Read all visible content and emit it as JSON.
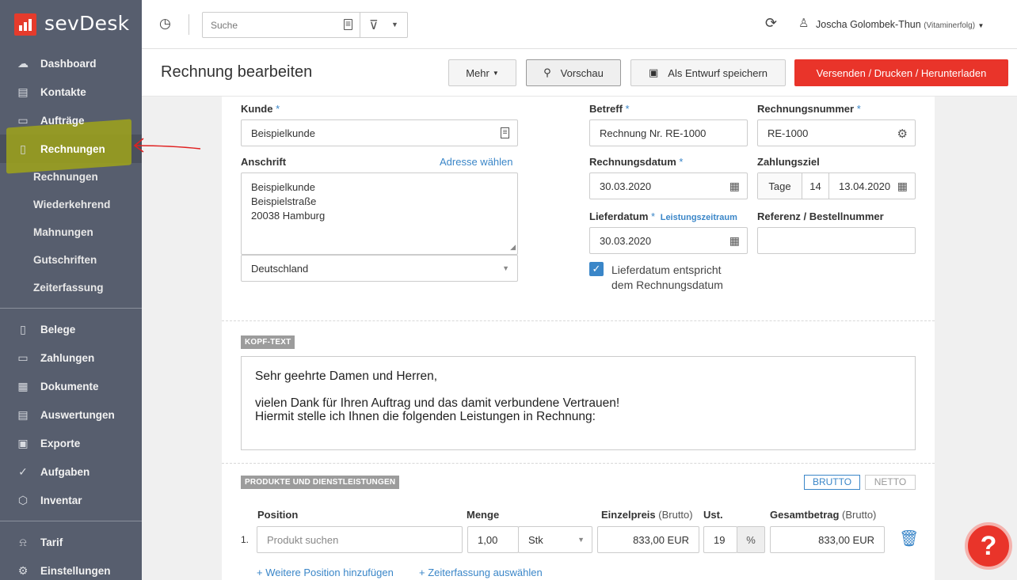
{
  "brand": {
    "name": "sevDesk"
  },
  "sidebar": {
    "items": [
      {
        "label": "Dashboard",
        "icon": "cloud-icon"
      },
      {
        "label": "Kontakte",
        "icon": "contact-card-icon"
      },
      {
        "label": "Aufträge",
        "icon": "folder-icon"
      },
      {
        "label": "Rechnungen",
        "icon": "document-icon"
      },
      {
        "label": "Belege",
        "icon": "receipt-icon"
      },
      {
        "label": "Zahlungen",
        "icon": "credit-card-icon"
      },
      {
        "label": "Dokumente",
        "icon": "calendar-doc-icon"
      },
      {
        "label": "Auswertungen",
        "icon": "chart-icon"
      },
      {
        "label": "Exporte",
        "icon": "export-icon"
      },
      {
        "label": "Aufgaben",
        "icon": "checkmark-icon"
      },
      {
        "label": "Inventar",
        "icon": "box-icon"
      },
      {
        "label": "Tarif",
        "icon": "bell-icon"
      },
      {
        "label": "Einstellungen",
        "icon": "gear-icon"
      }
    ],
    "subitems": [
      "Rechnungen",
      "Wiederkehrend",
      "Mahnungen",
      "Gutschriften",
      "Zeiterfassung"
    ]
  },
  "topbar": {
    "search_placeholder": "Suche",
    "user": "Joscha Golombek-Thun",
    "org": "(Vitaminerfolg)"
  },
  "header": {
    "title": "Rechnung bearbeiten",
    "more": "Mehr",
    "preview": "Vorschau",
    "draft": "Als Entwurf speichern",
    "send": "Versenden / Drucken / Herunterladen"
  },
  "form": {
    "kunde_label": "Kunde",
    "kunde_value": "Beispielkunde",
    "anschrift_label": "Anschrift",
    "adresse_link": "Adresse wählen",
    "address_lines": [
      "Beispielkunde",
      "Beispielstraße",
      "20038 Hamburg"
    ],
    "country": "Deutschland",
    "betreff_label": "Betreff",
    "betreff_value": "Rechnung Nr. RE-1000",
    "nummer_label": "Rechnungsnummer",
    "nummer_value": "RE-1000",
    "datum_label": "Rechnungsdatum",
    "datum_value": "30.03.2020",
    "ziel_label": "Zahlungsziel",
    "ziel_unit": "Tage",
    "ziel_days": "14",
    "ziel_date": "13.04.2020",
    "liefer_label": "Lieferdatum",
    "liefer_link": "Leistungszeitraum",
    "liefer_value": "30.03.2020",
    "referenz_label": "Referenz / Bestellnummer",
    "referenz_value": "",
    "checkbox_label_1": "Lieferdatum entspricht",
    "checkbox_label_2": "dem Rechnungsdatum",
    "required_mark": "*"
  },
  "kopf": {
    "tag": "KOPF-TEXT",
    "line1": "Sehr geehrte Damen und Herren,",
    "line2": "vielen Dank für Ihren Auftrag und das damit verbundene Vertrauen!",
    "line3": "Hiermit stelle ich Ihnen die folgenden Leistungen in Rechnung:"
  },
  "products": {
    "tag": "PRODUKTE UND DIENSTLEISTUNGEN",
    "brutto": "BRUTTO",
    "netto": "NETTO",
    "col_position": "Position",
    "col_menge": "Menge",
    "col_einzel": "Einzelpreis",
    "col_einzel_sub": "(Brutto)",
    "col_ust": "Ust.",
    "col_gesamt": "Gesamtbetrag",
    "col_gesamt_sub": "(Brutto)",
    "row_num": "1.",
    "row_placeholder": "Produkt suchen",
    "row_menge": "1,00",
    "row_unit": "Stk",
    "row_einzel": "833,00 EUR",
    "row_ust": "19",
    "row_pct": "%",
    "row_gesamt": "833,00 EUR",
    "add_position": "+ Weitere Position hinzufügen",
    "add_time": "+ Zeiterfassung auswählen"
  },
  "help": {
    "label": "?"
  },
  "colors": {
    "accent": "#e9342a",
    "link": "#3a86c8",
    "sidebar": "#575e6e"
  }
}
